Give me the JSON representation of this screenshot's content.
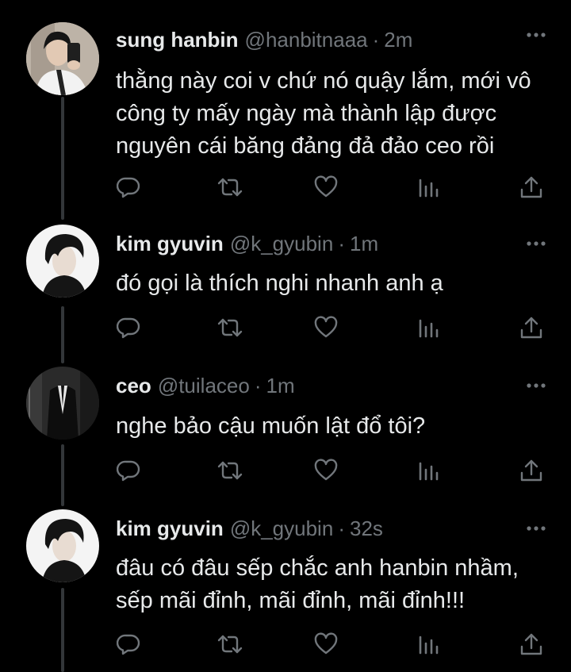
{
  "colors": {
    "background": "#000000",
    "primary_text": "#e7e9ea",
    "secondary_text": "#71767b",
    "thread_line": "#333639"
  },
  "tweets": [
    {
      "display_name": "sung hanbin",
      "handle": "@hanbitnaaa",
      "separator": "·",
      "time": "2m",
      "lines": [
        "thằng này coi v chứ nó quậy lắm, mới vô",
        "công ty mấy ngày mà thành lập được",
        "nguyên cái băng đảng đả đảo ceo rồi"
      ]
    },
    {
      "display_name": "kim gyuvin",
      "handle": "@k_gyubin",
      "separator": "·",
      "time": "1m",
      "lines": [
        "đó gọi là thích nghi nhanh anh ạ"
      ]
    },
    {
      "display_name": "ceo",
      "handle": "@tuilaceo",
      "separator": "·",
      "time": "1m",
      "lines": [
        "nghe bảo cậu muốn lật đổ tôi?"
      ]
    },
    {
      "display_name": "kim gyuvin",
      "handle": "@k_gyubin",
      "separator": "·",
      "time": "32s",
      "lines": [
        "đâu có đâu sếp chắc anh hanbin nhầm,",
        "sếp mãi đỉnh, mãi đỉnh, mãi đỉnh!!!"
      ]
    }
  ],
  "action_icons": [
    "reply-icon",
    "retweet-icon",
    "like-icon",
    "views-icon",
    "share-icon"
  ],
  "more_icon": "more-icon"
}
